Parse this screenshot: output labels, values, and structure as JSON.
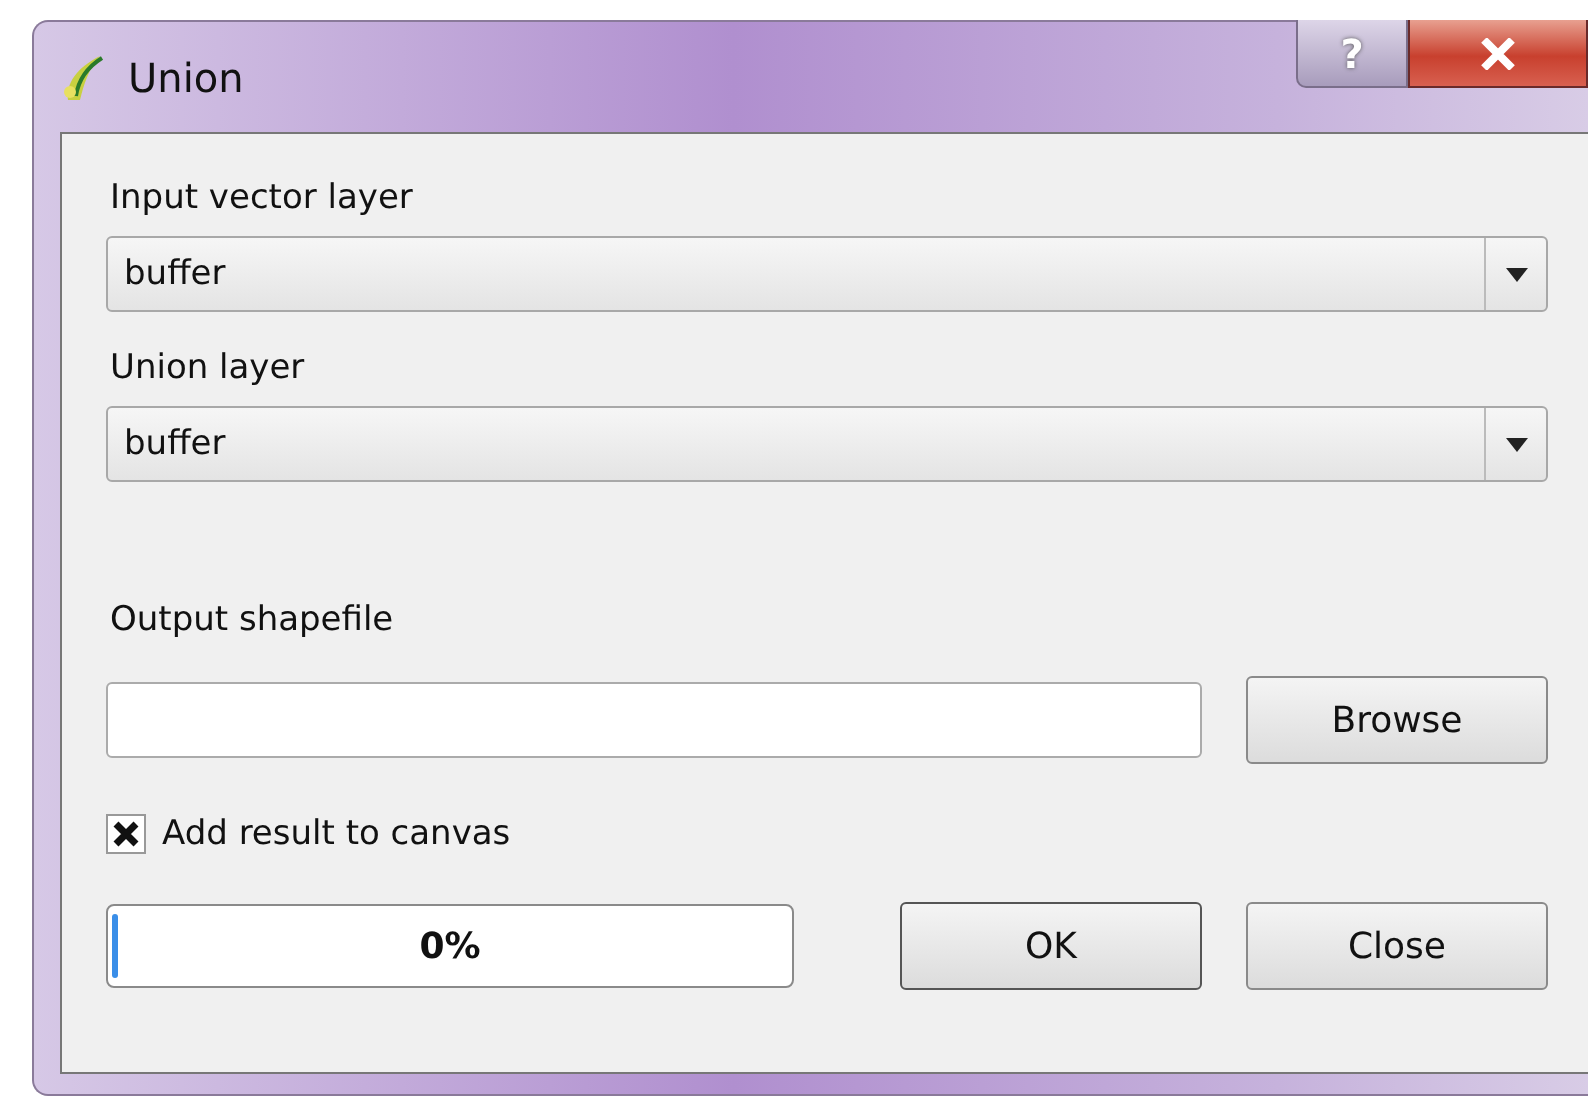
{
  "window": {
    "title": "Union",
    "help": "?"
  },
  "input_layer": {
    "label": "Input vector layer",
    "value": "buffer"
  },
  "union_layer": {
    "label": "Union layer",
    "value": "buffer"
  },
  "output": {
    "label": "Output shapefile",
    "browse": "Browse"
  },
  "add_result": {
    "label": "Add result to canvas",
    "checked": true
  },
  "progress": {
    "level": 0.01,
    "reading": "0%"
  },
  "buttons": [
    "OK",
    "Close"
  ]
}
